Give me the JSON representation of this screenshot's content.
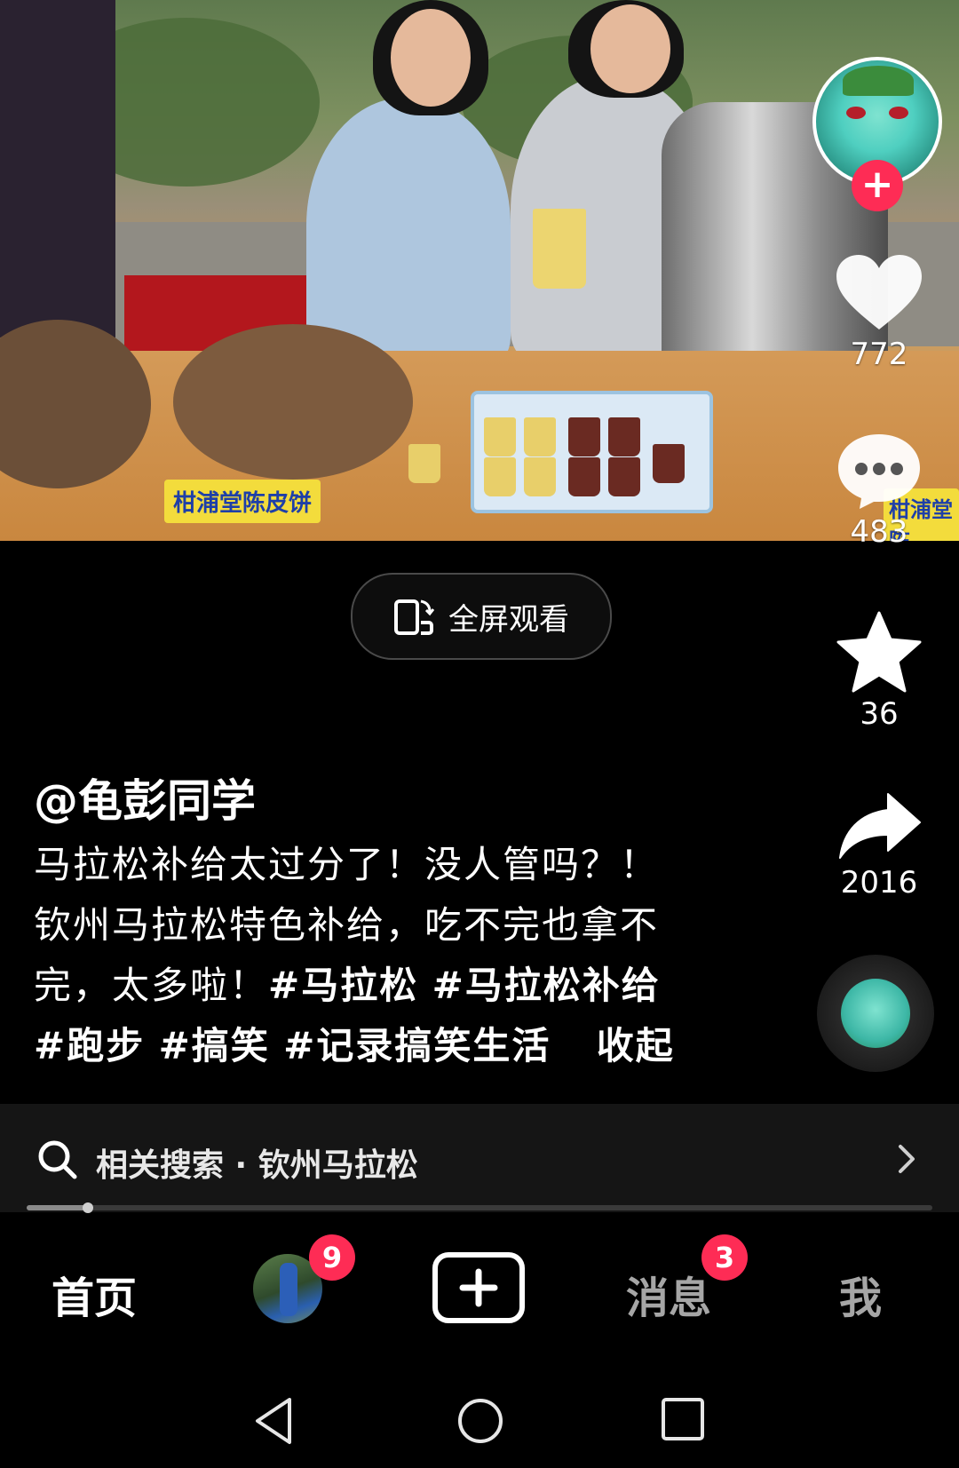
{
  "video": {
    "sign_left": "柑浦堂陈皮饼",
    "sign_right": "柑浦堂陈"
  },
  "fullscreen_button": {
    "label": "全屏观看"
  },
  "rail": {
    "likes": "772",
    "comments": "483",
    "favorites": "36",
    "shares": "2016"
  },
  "author": "@龟彭同学",
  "caption": {
    "line1": "马拉松补给太过分了！没人管吗？！",
    "line2": "钦州马拉松特色补给，吃不完也拿不",
    "line3_text": "完，太多啦！",
    "hashtags": [
      "#马拉松",
      "#马拉松补给",
      "#跑步",
      "#搞笑",
      "#记录搞笑生活"
    ],
    "collapse_label": "收起"
  },
  "related_search": {
    "label": "相关搜索 · 钦州马拉松"
  },
  "progress": {
    "value": 0.068
  },
  "tabs": {
    "home": "首页",
    "friends_badge": "9",
    "messages": "消息",
    "messages_badge": "3",
    "me": "我"
  },
  "colors": {
    "accent": "#fe2c55",
    "background": "#000000"
  }
}
